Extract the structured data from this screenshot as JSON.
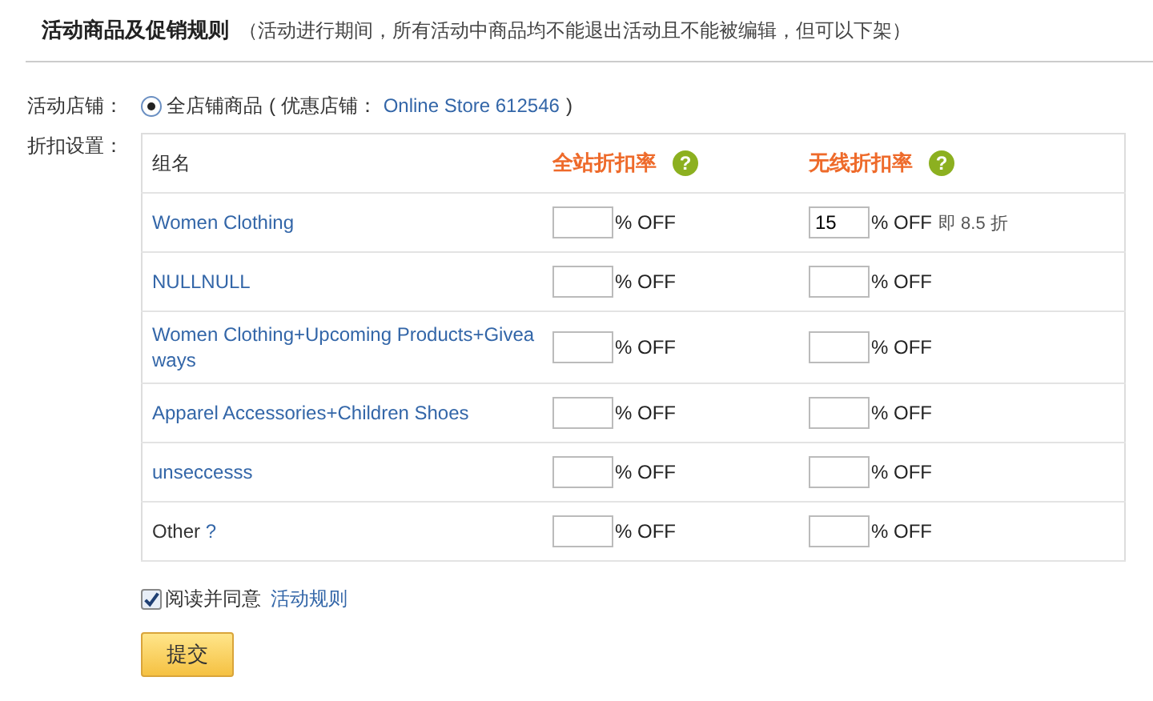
{
  "header": {
    "title": "活动商品及促销规则",
    "note": "（活动进行期间，所有活动中商品均不能退出活动且不能被编辑，但可以下架）"
  },
  "store": {
    "label": "活动店铺：",
    "option": "全店铺商品",
    "selected": true,
    "prefix": "( 优惠店铺：",
    "link": "Online Store 612546",
    "suffix": ")"
  },
  "discount": {
    "label": "折扣设置：",
    "columns": [
      {
        "label": "组名",
        "kind": "plain"
      },
      {
        "label": "全站折扣率",
        "kind": "rate",
        "help": "?"
      },
      {
        "label": "无线折扣率",
        "kind": "rate",
        "help": "?"
      }
    ],
    "rows": [
      {
        "cells": [
          {
            "name": "Women Clothing",
            "kind": "link"
          },
          {
            "unit": "% OFF"
          },
          {
            "value": "15",
            "unit": "% OFF",
            "note": "即 8.5 折"
          }
        ]
      },
      {
        "cells": [
          {
            "name": "NULLNULL",
            "kind": "link"
          },
          {
            "unit": "% OFF"
          },
          {
            "unit": "% OFF"
          }
        ]
      },
      {
        "cells": [
          {
            "name": "Women Clothing+Upcoming Products+Giveaways",
            "kind": "link"
          },
          {
            "unit": "% OFF"
          },
          {
            "unit": "% OFF"
          }
        ]
      },
      {
        "cells": [
          {
            "name": "Apparel Accessories+Children Shoes",
            "kind": "link"
          },
          {
            "unit": "% OFF"
          },
          {
            "unit": "% OFF"
          }
        ]
      },
      {
        "cells": [
          {
            "name": "unseccesss",
            "kind": "link"
          },
          {
            "unit": "% OFF"
          },
          {
            "unit": "% OFF"
          }
        ]
      },
      {
        "cells": [
          {
            "name": "Other",
            "kind": "plain",
            "help": "?"
          },
          {
            "unit": "% OFF"
          },
          {
            "unit": "% OFF"
          }
        ]
      }
    ]
  },
  "agree": {
    "checked": true,
    "text": "阅读并同意",
    "link": "活动规则"
  },
  "submit": "提交"
}
